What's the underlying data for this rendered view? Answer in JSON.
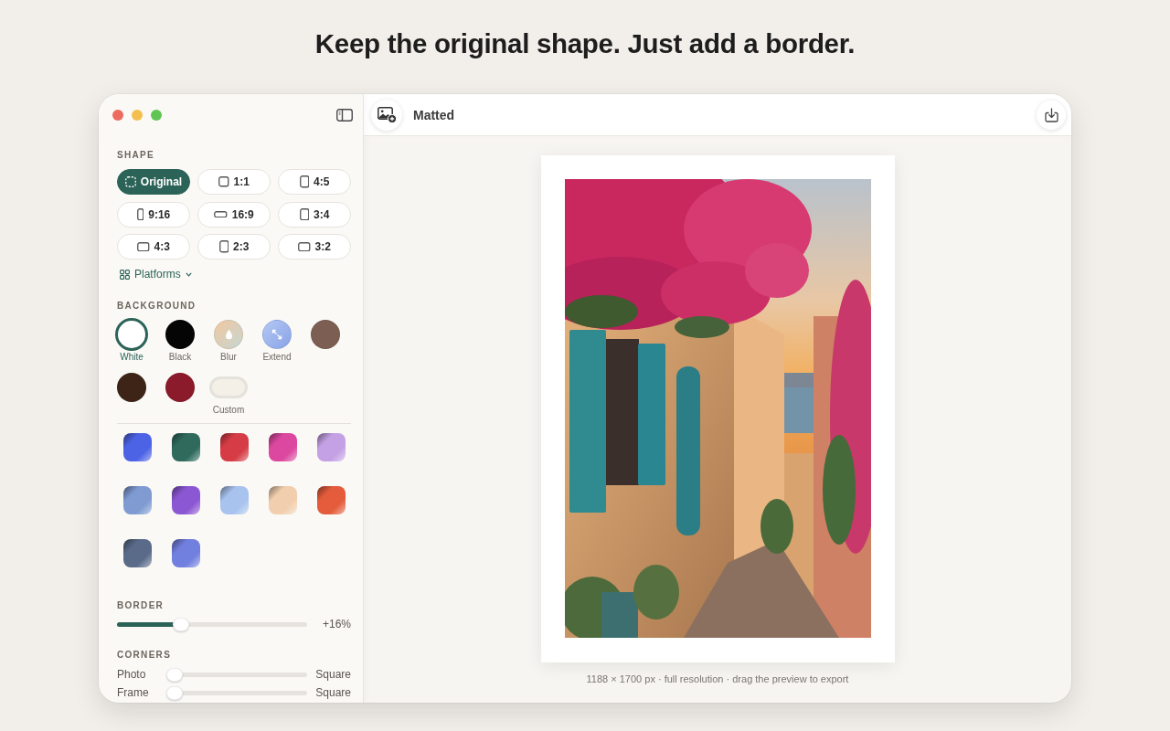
{
  "headline": "Keep the original shape. Just add a border.",
  "window": {
    "title": "Matted"
  },
  "sidebar": {
    "shape": {
      "label": "SHAPE",
      "options": [
        {
          "label": "Original",
          "kind": "free",
          "selected": true
        },
        {
          "label": "1:1",
          "kind": "square",
          "selected": false
        },
        {
          "label": "4:5",
          "kind": "portrait",
          "selected": false
        },
        {
          "label": "9:16",
          "kind": "tall",
          "selected": false
        },
        {
          "label": "16:9",
          "kind": "wide",
          "selected": false
        },
        {
          "label": "3:4",
          "kind": "portrait",
          "selected": false
        },
        {
          "label": "4:3",
          "kind": "landscape",
          "selected": false
        },
        {
          "label": "2:3",
          "kind": "portrait",
          "selected": false
        },
        {
          "label": "3:2",
          "kind": "landscape",
          "selected": false
        }
      ],
      "platforms": "Platforms"
    },
    "background": {
      "label": "BACKGROUND",
      "swatches": [
        {
          "label": "White",
          "kind": "solid",
          "color": "#ffffff",
          "selected": true
        },
        {
          "label": "Black",
          "kind": "solid",
          "color": "#050505",
          "selected": false
        },
        {
          "label": "Blur",
          "kind": "blur",
          "selected": false
        },
        {
          "label": "Extend",
          "kind": "extend",
          "selected": false
        },
        {
          "kind": "solid",
          "color": "#7d5e52",
          "selected": false
        },
        {
          "kind": "solid",
          "color": "#3d2417",
          "selected": false
        },
        {
          "kind": "solid",
          "color": "#8b1a2b",
          "selected": false
        },
        {
          "label": "Custom",
          "kind": "custom",
          "selected": false
        }
      ],
      "gradients": [
        {
          "color": "#4d63e6",
          "selected": false
        },
        {
          "color": "#2f6a5d",
          "selected": false
        },
        {
          "color": "#d53c45",
          "selected": false
        },
        {
          "color": "#dc479f",
          "selected": false
        },
        {
          "color": "#c4a0e4",
          "selected": false
        },
        {
          "color": "#7f9bd2",
          "selected": false
        },
        {
          "color": "#8c57d2",
          "selected": false
        },
        {
          "color": "#a8c3ee",
          "selected": false
        },
        {
          "color": "#f1cfae",
          "selected": false
        },
        {
          "color": "#e45c3c",
          "selected": false
        },
        {
          "color": "#5a6b8a",
          "selected": false
        },
        {
          "color": "#717fdf",
          "selected": false
        }
      ]
    },
    "border": {
      "label": "BORDER",
      "level": 0.32,
      "reading": "+16%"
    },
    "corners": {
      "label": "CORNERS",
      "sliders": [
        {
          "name": "Photo",
          "level": 0,
          "reading": "Square"
        },
        {
          "name": "Frame",
          "level": 0,
          "reading": "Square"
        }
      ]
    }
  },
  "preview": {
    "caption": "1188 × 1700 px · full resolution · drag the preview to export"
  }
}
